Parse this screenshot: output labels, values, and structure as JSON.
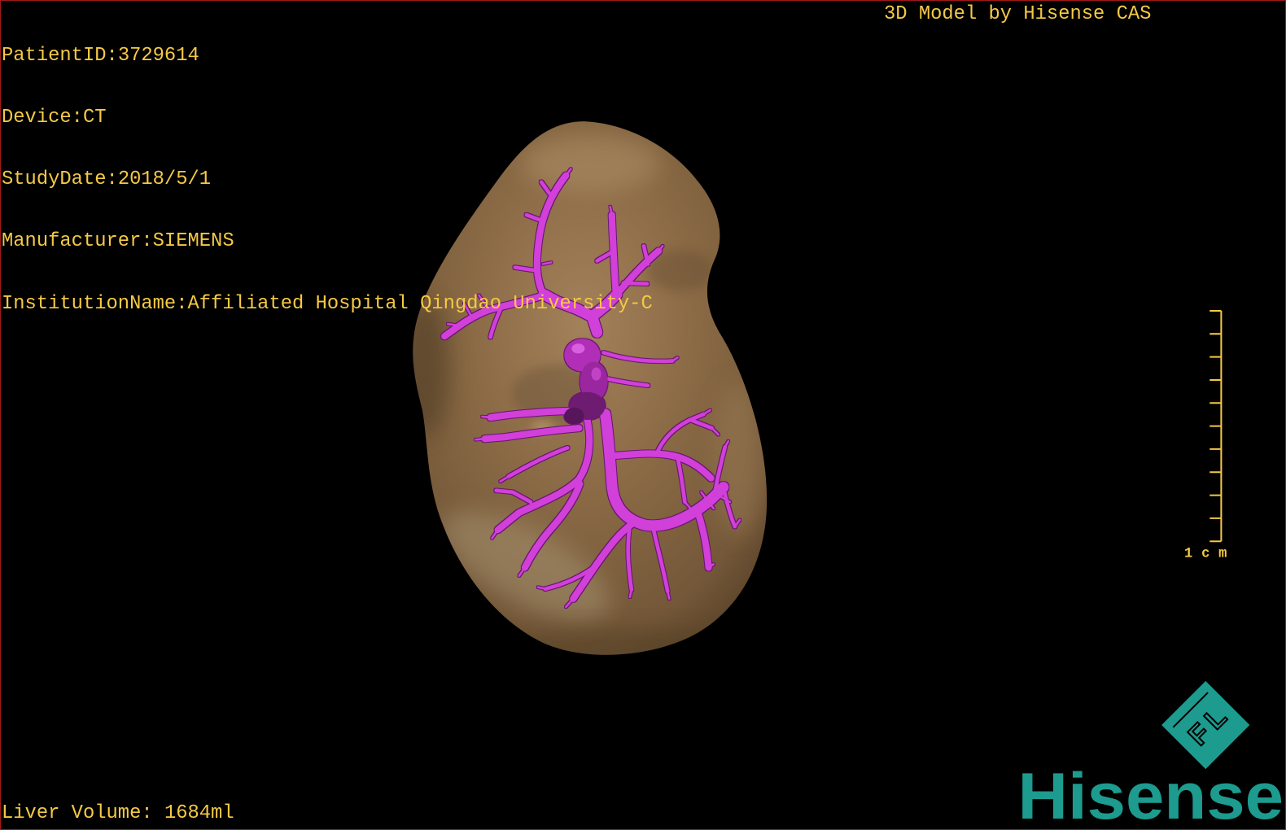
{
  "overlay": {
    "info": [
      {
        "label": "PatientID:",
        "value": "3729614"
      },
      {
        "label": "Device:",
        "value": "CT"
      },
      {
        "label": "StudyDate:",
        "value": "2018/5/1"
      },
      {
        "label": "Manufacturer:",
        "value": "SIEMENS"
      },
      {
        "label": "InstitutionName:",
        "value": "Affiliated Hospital Qingdao University-C"
      }
    ],
    "model_credit": "3D Model by Hisense CAS",
    "liver_volume": {
      "label": "Liver Volume: ",
      "value": "1684ml"
    }
  },
  "scale_bar": {
    "label": "1cm"
  },
  "logo": {
    "brand": "Hisense",
    "emblem_letters": [
      "F",
      "L"
    ],
    "emblem_icon": "hisense-fl-emblem-icon"
  },
  "colors": {
    "overlay_text": "#f5c945",
    "vessel": "#d13fd9",
    "liver": "#8a6a45",
    "brand": "#1c9b8e",
    "frame": "#a31818",
    "background": "#000000"
  }
}
